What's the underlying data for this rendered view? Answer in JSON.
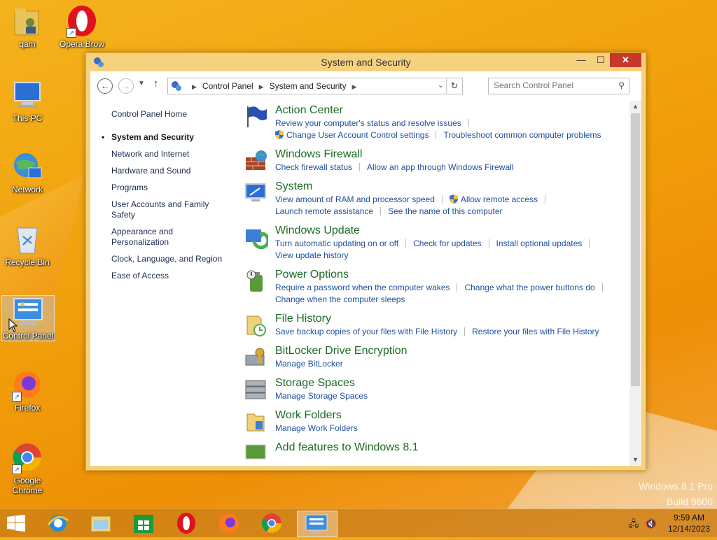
{
  "desktop": {
    "icons": [
      {
        "label": "qam",
        "icon": "user-folder-icon"
      },
      {
        "label": "Opera Brow",
        "icon": "opera-icon"
      },
      {
        "label": "This PC",
        "icon": "computer-icon"
      },
      {
        "label": "Network",
        "icon": "network-icon"
      },
      {
        "label": "Recycle Bin",
        "icon": "recycle-bin-icon"
      },
      {
        "label": "Control Panel",
        "icon": "control-panel-icon"
      },
      {
        "label": "Firefox",
        "icon": "firefox-icon"
      },
      {
        "label": "Google Chrome",
        "icon": "chrome-icon"
      }
    ],
    "watermark": {
      "line1": "Windows 8.1 Pro",
      "line2": "Build 9600"
    }
  },
  "window": {
    "title": "System and Security",
    "controls": {
      "minimize": "—",
      "maximize": "☐",
      "close": "✕"
    },
    "address": {
      "crumb1": "Control Panel",
      "crumb2": "System and Security"
    },
    "search": {
      "placeholder": "Search Control Panel"
    },
    "leftnav": {
      "home": "Control Panel Home",
      "items": [
        "System and Security",
        "Network and Internet",
        "Hardware and Sound",
        "Programs",
        "User Accounts and Family Safety",
        "Appearance and Personalization",
        "Clock, Language, and Region",
        "Ease of Access"
      ]
    },
    "categories": [
      {
        "title": "Action Center",
        "icon": "flag-icon",
        "line1": [
          "Review your computer's status and resolve issues"
        ],
        "line2": [
          "Change User Account Control settings",
          "Troubleshoot common computer problems"
        ]
      },
      {
        "title": "Windows Firewall",
        "icon": "firewall-icon",
        "line1": [
          "Check firewall status",
          "Allow an app through Windows Firewall"
        ]
      },
      {
        "title": "System",
        "icon": "system-icon",
        "line1": [
          "View amount of RAM and processor speed",
          "Allow remote access"
        ],
        "line2": [
          "Launch remote assistance",
          "See the name of this computer"
        ]
      },
      {
        "title": "Windows Update",
        "icon": "windows-update-icon",
        "line1": [
          "Turn automatic updating on or off",
          "Check for updates",
          "Install optional updates"
        ],
        "line2": [
          "View update history"
        ]
      },
      {
        "title": "Power Options",
        "icon": "power-options-icon",
        "line1": [
          "Require a password when the computer wakes",
          "Change what the power buttons do"
        ],
        "line2": [
          "Change when the computer sleeps"
        ]
      },
      {
        "title": "File History",
        "icon": "file-history-icon",
        "line1": [
          "Save backup copies of your files with File History",
          "Restore your files with File History"
        ]
      },
      {
        "title": "BitLocker Drive Encryption",
        "icon": "bitlocker-icon",
        "line1": [
          "Manage BitLocker"
        ]
      },
      {
        "title": "Storage Spaces",
        "icon": "storage-spaces-icon",
        "line1": [
          "Manage Storage Spaces"
        ]
      },
      {
        "title": "Work Folders",
        "icon": "work-folders-icon",
        "line1": [
          "Manage Work Folders"
        ]
      },
      {
        "title": "Add features to Windows 8.1",
        "icon": "add-features-icon"
      }
    ]
  },
  "taskbar": {
    "apps": [
      "internet-explorer-icon",
      "file-explorer-icon",
      "store-icon",
      "opera-icon",
      "firefox-icon",
      "chrome-icon",
      "control-panel-icon"
    ],
    "time": "9:59 AM",
    "date": "12/14/2023"
  },
  "colors": {
    "accent_green": "#1c6a24",
    "link_blue": "#1f4f9f",
    "close_red": "#c7382b"
  }
}
